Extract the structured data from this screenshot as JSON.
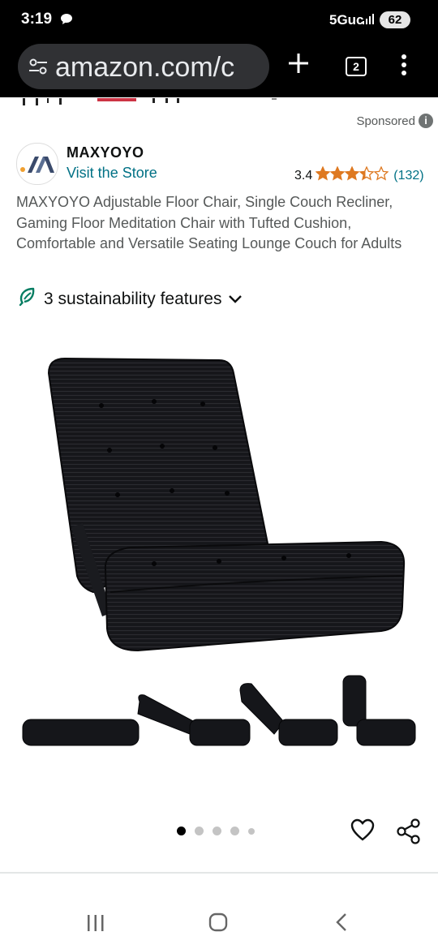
{
  "status_bar": {
    "time": "3:19",
    "network": "5Guc",
    "battery": "62"
  },
  "browser": {
    "url": "amazon.com/c",
    "tab_count": "2"
  },
  "ad": {
    "sponsored_label": "Sponsored",
    "brand_name": "MAXYOYO",
    "store_link": "Visit the Store",
    "rating_value": "3.4",
    "rating_stars": 3.4,
    "review_count": "(132)",
    "product_title": "MAXYOYO Adjustable Floor Chair, Single Couch Recliner, Gaming Floor Meditation Chair with Tufted Cushion, Comfortable and Versatile Seating Lounge Couch for Adults",
    "sustainability_label": "3 sustainability features"
  },
  "carousel": {
    "total_images": 5,
    "active_index": 0
  },
  "colors": {
    "link": "#007185",
    "star": "#de7921",
    "leaf": "#067d62"
  }
}
